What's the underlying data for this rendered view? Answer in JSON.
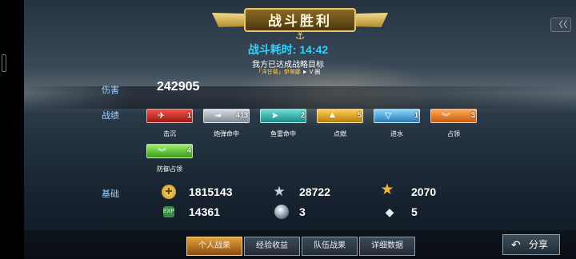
{
  "banner": {
    "title": "战斗胜利",
    "close_label": "〈〈"
  },
  "battle": {
    "time": "战斗耗时: 14:42",
    "goal": "我方已达成战略目标",
    "ship": "「洋甘菊」伊琳娜",
    "ship_suffix": "► V 圈"
  },
  "labels": {
    "damage": "伤害",
    "record": "战绩",
    "basic": "基础"
  },
  "damage_value": "242905",
  "medals": [
    {
      "name": "击沉",
      "count": "1",
      "color": "red",
      "emblem": "plane-icon"
    },
    {
      "name": "炮弹命中",
      "count": "413",
      "color": "gray",
      "emblem": "shell-icon"
    },
    {
      "name": "鱼雷命中",
      "count": "2",
      "color": "teal",
      "emblem": "torpedo-icon"
    },
    {
      "name": "点燃",
      "count": "5",
      "color": "gold",
      "emblem": "fire-icon"
    },
    {
      "name": "进水",
      "count": "1",
      "color": "blue",
      "emblem": "flood-icon"
    },
    {
      "name": "占领",
      "count": "3",
      "color": "orange",
      "emblem": "chevron-icon"
    },
    {
      "name": "防御占领",
      "count": "4",
      "color": "green",
      "emblem": "chevron-icon"
    }
  ],
  "stats": {
    "coins": "1815143",
    "silver_star": "28722",
    "gold_star": "2070",
    "exp": "14361",
    "sphere": "3",
    "diamond": "5"
  },
  "tabs": [
    "个人战果",
    "经验收益",
    "队伍战果",
    "详细数据"
  ],
  "share_label": "分享",
  "colors": {
    "accent": "#2fd3ff",
    "label": "#9fd1ff",
    "gold": "#e7c76a"
  }
}
